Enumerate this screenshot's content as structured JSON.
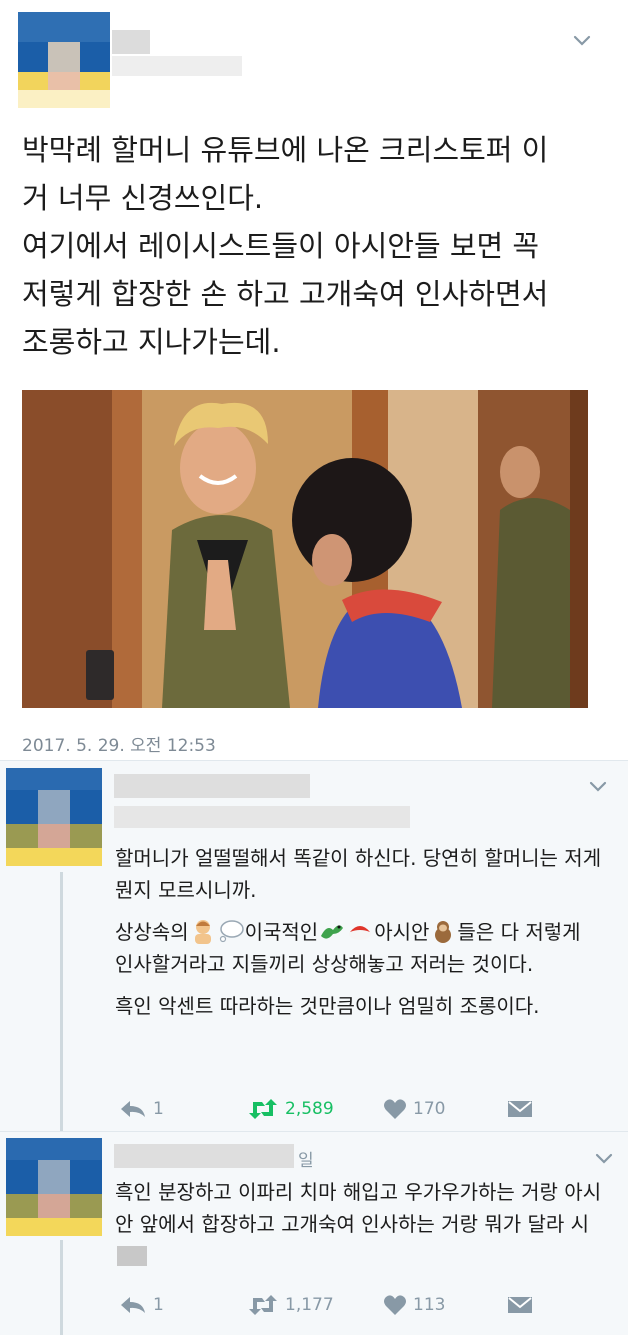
{
  "main_tweet": {
    "text_lines": [
      "박막례 할머니 유튜브에 나온 크리스토퍼 이\n거 너무 신경쓰인다.",
      "여기에서 레이시스트들이 아시안들 보면 꼭\n저렇게 합장한 손 하고 고개숙여 인사하면서\n조롱하고 지나가는데."
    ],
    "timestamp": "2017. 5. 29. 오전 12:53",
    "menu_icon": "chevron-down-icon",
    "photo_alt": ""
  },
  "replies": [
    {
      "handle_suffix": "",
      "paragraphs": [
        "할머니가 얼떨떨해서 똑같이 하신다. 당연히 할머니는 저게 뭔지 모르시니까.",
        {
          "parts": [
            "상상속의",
            "이국적인",
            "아시안",
            "들은 다 저렇게 인사할거라고 지들끼리 상상해놓고 저러는 것이다."
          ],
          "emojis": [
            "person-bowing-emoji",
            "thought-balloon-emoji",
            "dragon-emoji",
            "sushi-emoji",
            "monkey-emoji"
          ]
        },
        "흑인 악센트 따라하는 것만큼이나 엄밀히 조롱이다."
      ],
      "reply_count": "1",
      "retweet_count": "2,589",
      "like_count": "170",
      "retweeted": true
    },
    {
      "handle_suffix": "일",
      "paragraphs": [
        "흑인 분장하고 이파리 치마 해입고 우가우가하는 거랑 아시안 앞에서 합장하고 고개숙여 인사하는 거랑 뭐가 달라 시"
      ],
      "reply_count": "1",
      "retweet_count": "1,177",
      "like_count": "113",
      "retweeted": false
    }
  ],
  "colors": {
    "retweet_active": "#17bf63",
    "icon_gray": "#8899a6",
    "reply_background": "#f5f8fa"
  }
}
